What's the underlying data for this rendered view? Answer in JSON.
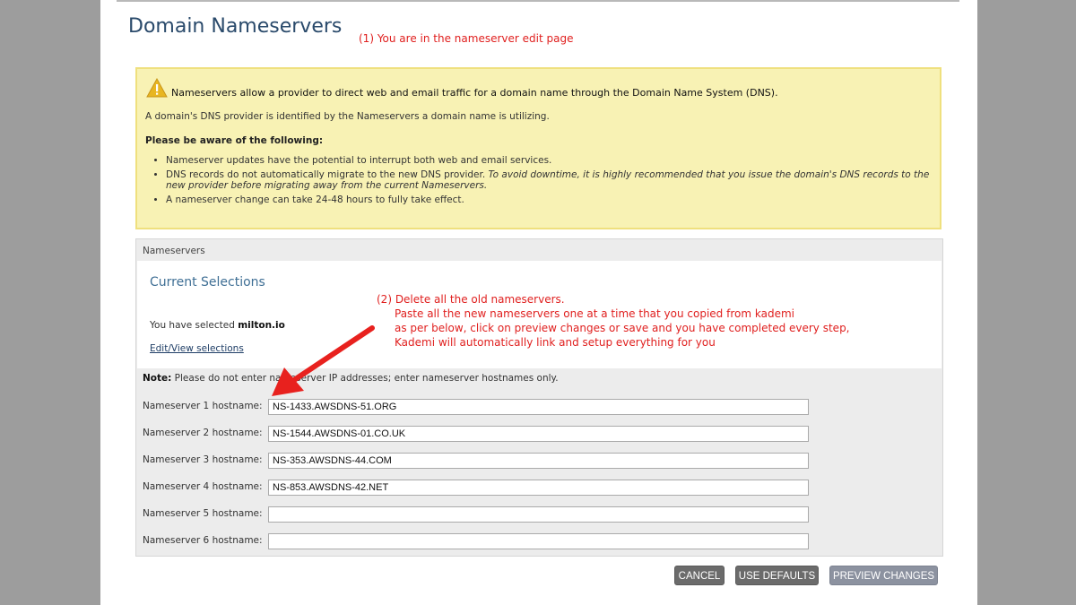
{
  "page": {
    "title": "Domain Nameservers"
  },
  "annotations": {
    "step1": "(1)  You are in the nameserver edit page",
    "step2": [
      "(2)  Delete all the old nameservers.",
      "Paste all the new nameservers one at a time that you copied from kademi",
      "as per below, click on preview changes or save and you have completed every step,",
      "Kademi will automatically link and setup everything for you"
    ]
  },
  "warning": {
    "icon": "warning-triangle-icon",
    "heading": "Nameservers allow a provider to direct web and email traffic for a domain name through the Domain Name System (DNS).",
    "intro": "A domain's DNS provider is identified by the Nameservers a domain name is utilizing.",
    "aware_label": "Please be aware of the following:",
    "bullets": {
      "b1": "Nameserver updates have the potential to interrupt both web and email services.",
      "b2_plain": "DNS records do not automatically migrate to the new DNS provider. ",
      "b2_italic": "To avoid downtime, it is highly recommended that you issue the domain's DNS records to the new provider before migrating away from the current Nameservers.",
      "b3": "A nameserver change can take 24-48 hours to fully take effect."
    }
  },
  "panel": {
    "header": "Nameservers",
    "current_selections": "Current Selections",
    "selected_prefix": "You have selected ",
    "selected_domain": "milton.io",
    "edit_link": "Edit/View selections",
    "note_label": "Note:",
    "note_text": " Please do not enter nameserver IP addresses; enter nameserver hostnames only."
  },
  "nameservers": [
    {
      "label": "Nameserver 1 hostname:",
      "value": "NS-1433.AWSDNS-51.ORG"
    },
    {
      "label": "Nameserver 2 hostname:",
      "value": "NS-1544.AWSDNS-01.CO.UK"
    },
    {
      "label": "Nameserver 3 hostname:",
      "value": "NS-353.AWSDNS-44.COM"
    },
    {
      "label": "Nameserver 4 hostname:",
      "value": "NS-853.AWSDNS-42.NET"
    },
    {
      "label": "Nameserver 5 hostname:",
      "value": ""
    },
    {
      "label": "Nameserver 6 hostname:",
      "value": ""
    }
  ],
  "buttons": {
    "cancel": "CANCEL",
    "use_defaults": "USE DEFAULTS",
    "preview": "PREVIEW CHANGES"
  },
  "colors": {
    "annotation": "#e0201f",
    "warning_bg": "#f8f2b4",
    "title": "#2a4a6b"
  }
}
